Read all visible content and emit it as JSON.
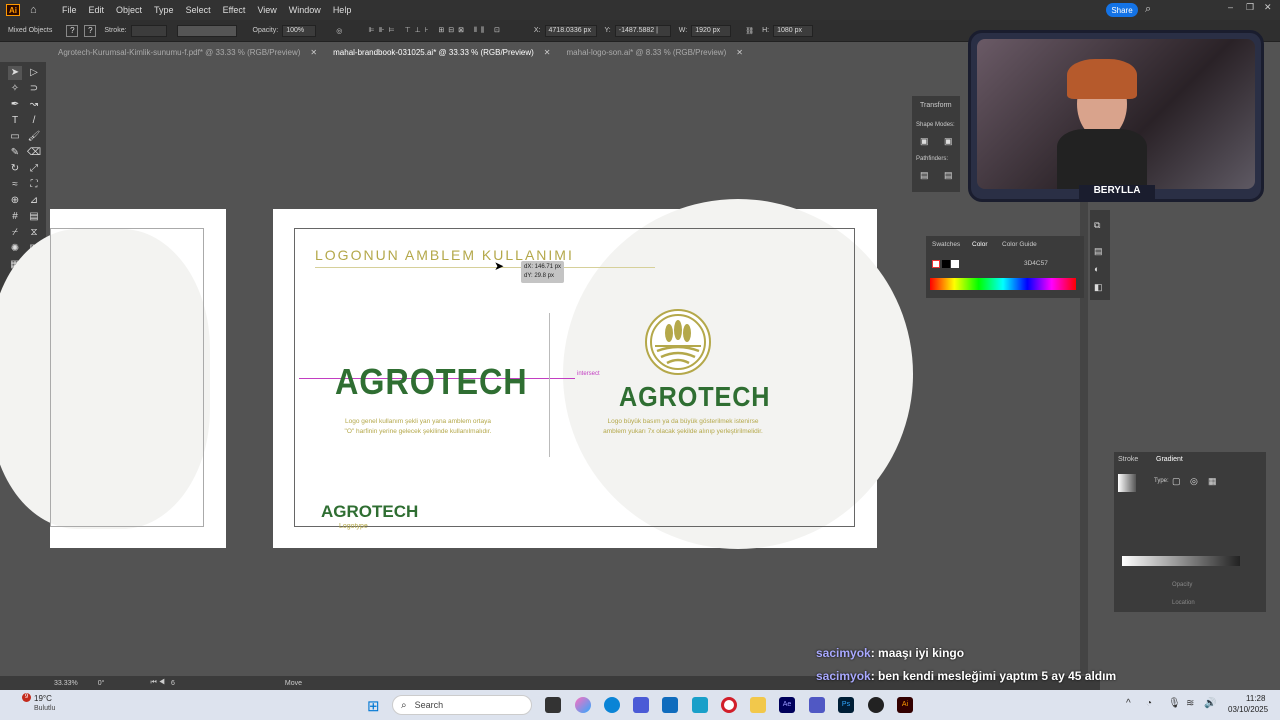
{
  "menubar": {
    "items": [
      "File",
      "Edit",
      "Object",
      "Type",
      "Select",
      "Effect",
      "View",
      "Window",
      "Help"
    ],
    "share_label": "Share"
  },
  "controlbar": {
    "selection": "Mixed Objects",
    "stroke_label": "Stroke:",
    "opacity_label": "Opacity:",
    "opacity_value": "100%",
    "x_label": "X:",
    "x_value": "4718.0336 px",
    "y_label": "Y:",
    "y_value": "-1487.5882 |",
    "w_label": "W:",
    "w_value": "1920 px",
    "h_label": "H:",
    "h_value": "1080 px"
  },
  "tabs": [
    {
      "label": "Agrotech-Kurumsal-Kimlik-sunumu-f.pdf* @ 33.33 % (RGB/Preview)"
    },
    {
      "label": "mahal-brandbook-031025.ai* @ 33.33 % (RGB/Preview)"
    },
    {
      "label": "mahal-logo-son.ai* @ 8.33 % (RGB/Preview)"
    }
  ],
  "artboard": {
    "heading": "LOGONUN AMBLEM KULLANIMI",
    "smart_guide_dx": "dX: 146.71 px",
    "smart_guide_dy": "dY: 29.8 px",
    "intersect_label": "intersect",
    "left_logo": "AGROTECH",
    "left_caption_1": "Logo genel kullanım şekli yan yana amblem ortaya",
    "left_caption_2": "\"O\" harfinin yerine gelecek şekilinde kullanılmalıdır.",
    "right_logo": "AGROTECH",
    "right_caption_1": "Logo büyük basım ya da büyük gösterilmek istenirse",
    "right_caption_2": "amblem yukarı 7x olacak şekilde alınıp yerleştirilmelidir.",
    "footer_logo": "AGROTECH",
    "footer_label": "Logotype"
  },
  "panels": {
    "transform_title": "Transform",
    "shape_modes": "Shape Modes:",
    "pathfinders": "Pathfinders:",
    "swatches_tab": "Swatches",
    "color_tab": "Color",
    "color_guide_tab": "Color Guide",
    "hex_value": "3D4C57",
    "stroke_tab": "Stroke",
    "gradient_tab": "Gradient",
    "type_label": "Type:",
    "opacity_label": "Opacity",
    "location_label": "Location"
  },
  "webcam": {
    "name": "BERYLLA"
  },
  "statusbar": {
    "zoom": "33.33%",
    "rotation": "0°",
    "artboard_num": "6",
    "tool": "Move"
  },
  "chat": [
    {
      "user": "sacimyok",
      "message": ": maaşı iyi kingo"
    },
    {
      "user": "sacimyok",
      "message": ": ben kendi mesleğimi yaptım 5 ay 45 aldım"
    }
  ],
  "taskbar": {
    "weather_temp": "19°C",
    "weather_desc": "Bulutlu",
    "notification_count": "9",
    "search_placeholder": "Search",
    "time": "11:28",
    "date": "03/10/2025"
  },
  "colors": {
    "brand_green": "#2f6e32",
    "brand_gold": "#b4a84a",
    "guide_magenta": "#c23ec2"
  }
}
